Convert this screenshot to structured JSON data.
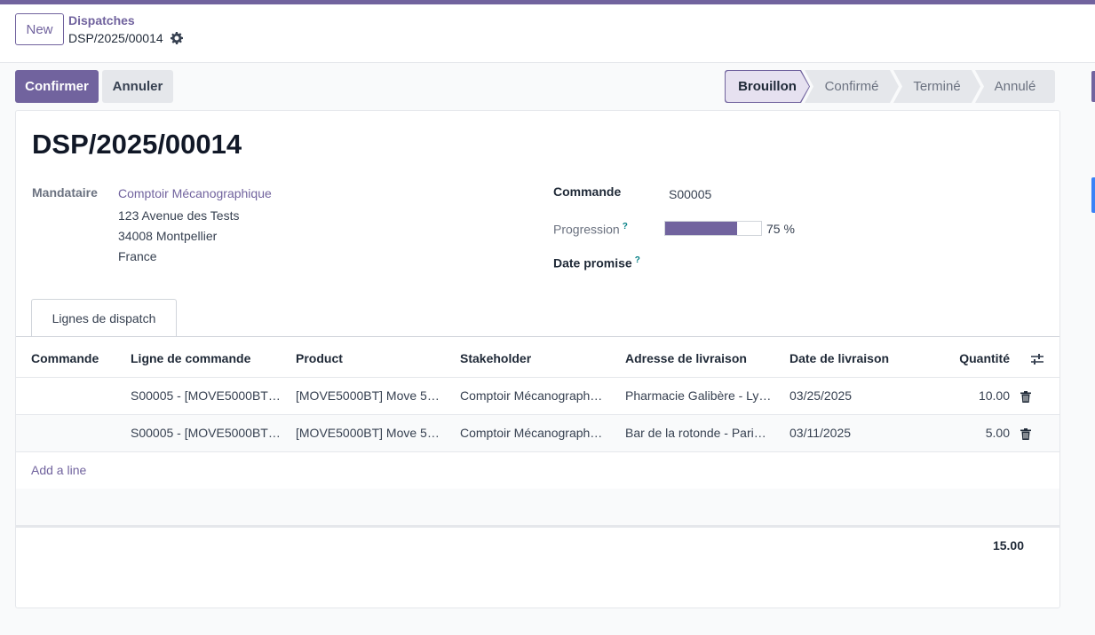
{
  "control_panel": {
    "new_label": "New",
    "breadcrumb_parent": "Dispatches",
    "breadcrumb_current": "DSP/2025/00014"
  },
  "actions": {
    "confirm_label": "Confirmer",
    "cancel_label": "Annuler"
  },
  "statusbar": {
    "stages": [
      "Brouillon",
      "Confirmé",
      "Terminé",
      "Annulé"
    ],
    "active": "Brouillon"
  },
  "record": {
    "title": "DSP/2025/00014",
    "mandataire_label": "Mandataire",
    "mandataire_name": "Comptoir Mécanographique",
    "address_line1": "123 Avenue des Tests",
    "address_line2": "34008 Montpellier",
    "address_line3": "France",
    "commande_label": "Commande",
    "commande_value": "S00005",
    "progression_label": "Progression",
    "progression_value": 75,
    "progression_text": "75 %",
    "date_promise_label": "Date promise",
    "help_mark": "?"
  },
  "tabs": {
    "lines_label": "Lignes de dispatch"
  },
  "table": {
    "headers": [
      "Commande",
      "Ligne de commande",
      "Product",
      "Stakeholder",
      "Adresse de livraison",
      "Date de livraison",
      "Quantité"
    ],
    "rows": [
      {
        "commande": "",
        "ligne": "S00005 - [MOVE5000BT…",
        "product": "[MOVE5000BT] Move 5…",
        "stakeholder": "Comptoir Mécanograph…",
        "adresse": "Pharmacie Galibère - Ly…",
        "date": "03/25/2025",
        "quantite": "10.00"
      },
      {
        "commande": "",
        "ligne": "S00005 - [MOVE5000BT…",
        "product": "[MOVE5000BT] Move 5…",
        "stakeholder": "Comptoir Mécanograph…",
        "adresse": "Bar de la rotonde - Pari…",
        "date": "03/11/2025",
        "quantite": "5.00"
      }
    ],
    "add_line_label": "Add a line",
    "total": "15.00"
  },
  "colors": {
    "brand": "#71639e",
    "help": "#017e84"
  }
}
